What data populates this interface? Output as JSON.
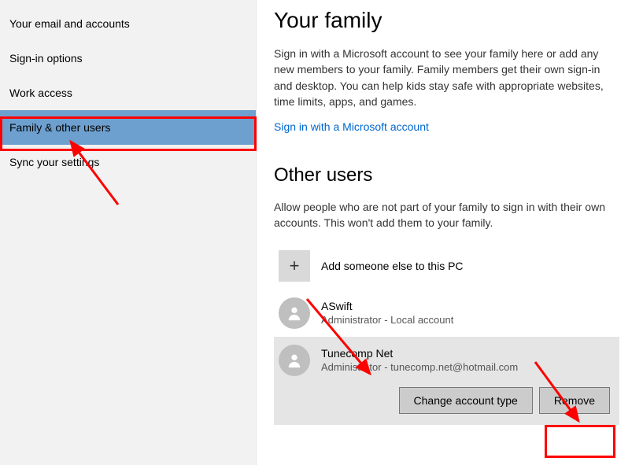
{
  "sidebar": {
    "items": [
      {
        "label": "Your email and accounts"
      },
      {
        "label": "Sign-in options"
      },
      {
        "label": "Work access"
      },
      {
        "label": "Family & other users"
      },
      {
        "label": "Sync your settings"
      }
    ]
  },
  "family": {
    "heading": "Your family",
    "desc": "Sign in with a Microsoft account to see your family here or add any new members to your family. Family members get their own sign-in and desktop. You can help kids stay safe with appropriate websites, time limits, apps, and games.",
    "link": "Sign in with a Microsoft account"
  },
  "other": {
    "heading": "Other users",
    "desc": "Allow people who are not part of your family to sign in with their own accounts. This won't add them to your family.",
    "add": "Add someone else to this PC",
    "users": [
      {
        "name": "ASwift",
        "sub": "Administrator - Local account"
      },
      {
        "name": "Tunecomp Net",
        "sub": "Administrator - tunecomp.net@hotmail.com"
      }
    ],
    "buttons": {
      "change": "Change account type",
      "remove": "Remove"
    }
  }
}
